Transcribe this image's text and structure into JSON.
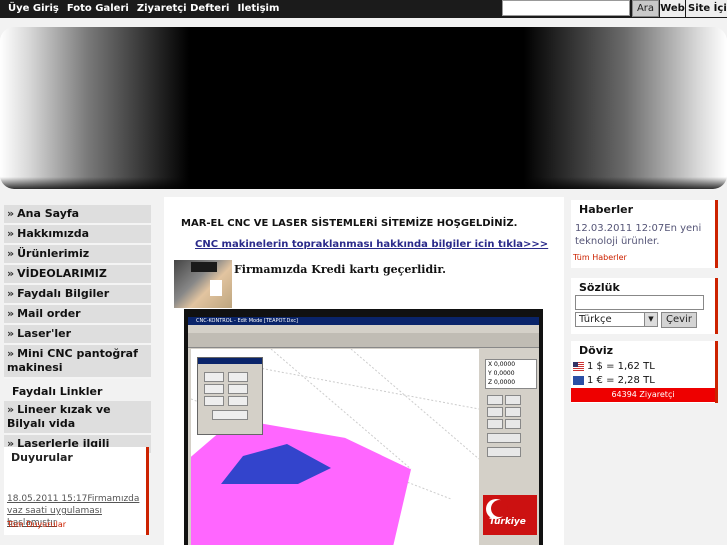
{
  "topnav": [
    "Üye Giriş",
    "Foto Galeri",
    "Ziyaretçi Defteri",
    "Iletişim"
  ],
  "search": {
    "value": "",
    "button": "Ara",
    "web": "Web",
    "site": "Site İçi"
  },
  "leftnav": {
    "items": [
      "Ana Sayfa",
      "Hakkımızda",
      "Ürünlerimiz",
      "VİDEOLARIMIZ",
      "Faydalı Bilgiler",
      "Mail order",
      "Laser'ler",
      "Mini CNC pantoğraf makinesi"
    ],
    "links_title": "Faydalı Linkler",
    "links": [
      "Lineer kızak ve Bilyalı vida",
      "Laserlerle ilgili"
    ]
  },
  "duyurular": {
    "title": "Duyurular",
    "text": "18.05.2011 15:17Firmamızda vaz saati uygulaması başlamıştır",
    "all": "Tüm Duyurular"
  },
  "main": {
    "welcome": "MAR-EL CNC VE LASER SİSTEMLERİ SİTEMİZE HOŞGELDİNİZ.",
    "cnc_link": "CNC makinelerin topraklanması hakkında bilgiler icin tıkla>>>",
    "card_text": "Firmamızda Kredi kartı geçerlidir.",
    "screenshot": {
      "window_title": "CNC-KONTROL - Edit Mode [TEAPOT.Dxc]",
      "coords": [
        "X  0,0000",
        "Y  0,0000",
        "Z  0,0000"
      ],
      "logo_text": "Türkiye"
    }
  },
  "haberler": {
    "title": "Haberler",
    "news": "12.03.2011 12:07En yeni teknoloji ürünler.",
    "all": "Tüm Haberler"
  },
  "sozluk": {
    "title": "Sözlük",
    "input_value": "",
    "language": "Türkçe",
    "button": "Çevir"
  },
  "doviz": {
    "title": "Döviz",
    "usd": "1 $ = 1,62 TL",
    "eur": "1 € = 2,28 TL",
    "visits": "64394 Ziyaretçi"
  },
  "colors": {
    "accent": "#cc2200",
    "topbar": "#1b1b1b",
    "visits_bg": "#ee0000",
    "magenta": "#ff66ff"
  }
}
